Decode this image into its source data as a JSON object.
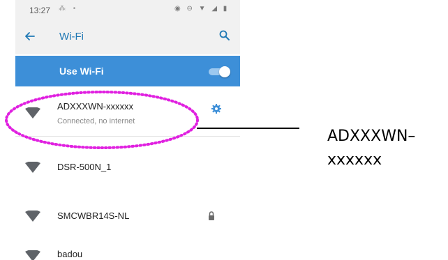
{
  "status_bar": {
    "time": "13:27",
    "left_icons": "⁂ •",
    "right_icons": "◉ ⊖ ▼ ◢ ▮"
  },
  "app_bar": {
    "title": "Wi-Fi",
    "back_icon": "arrow-left-icon",
    "search_icon": "search-icon"
  },
  "wifi_toggle": {
    "label": "Use Wi-Fi",
    "enabled": true
  },
  "networks": [
    {
      "name": "ADXXXWN-xxxxxx",
      "status": "Connected, no internet",
      "secured": false,
      "action_icon": "gear-icon"
    },
    {
      "name": "DSR-500N_1",
      "secured": false
    },
    {
      "name": "SMCWBR14S-NL",
      "secured": true,
      "action_icon": "lock-icon"
    },
    {
      "name": "badou",
      "secured": false
    }
  ],
  "callout": {
    "text": "ADXXXWN–xxxxxx"
  },
  "colors": {
    "accent_blue": "#3d8fd8",
    "title_blue": "#1f78b4",
    "highlight_magenta": "#e020e0",
    "app_bar_gray": "#f1f1f1",
    "wifi_icon_gray": "#5f6368"
  }
}
